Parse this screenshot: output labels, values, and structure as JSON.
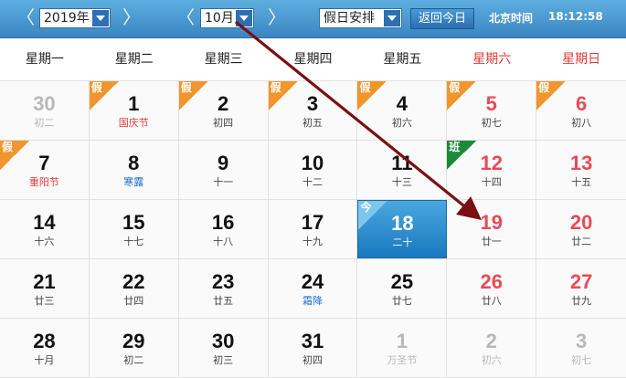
{
  "toolbar": {
    "prev_year": "〈",
    "year": "2019年",
    "next_year": "〉",
    "prev_month": "〈",
    "month": "10月",
    "next_month": "〉",
    "holiday_select": "假日安排",
    "today_button": "返回今日",
    "time_label": "北京时间",
    "time_value": "18:12:58"
  },
  "weekdays": [
    "星期一",
    "星期二",
    "星期三",
    "星期四",
    "星期五",
    "星期六",
    "星期日"
  ],
  "weeks": [
    [
      {
        "day": "30",
        "sub": "初二",
        "faded": true
      },
      {
        "day": "1",
        "sub": "国庆节",
        "subType": "fest",
        "badge": "假"
      },
      {
        "day": "2",
        "sub": "初四",
        "badge": "假"
      },
      {
        "day": "3",
        "sub": "初五",
        "badge": "假"
      },
      {
        "day": "4",
        "sub": "初六",
        "badge": "假"
      },
      {
        "day": "5",
        "sub": "初七",
        "badge": "假",
        "weekend": true
      },
      {
        "day": "6",
        "sub": "初八",
        "badge": "假",
        "weekend": true
      }
    ],
    [
      {
        "day": "7",
        "sub": "重阳节",
        "subType": "fest",
        "badge": "假"
      },
      {
        "day": "8",
        "sub": "寒露",
        "subType": "term"
      },
      {
        "day": "9",
        "sub": "十一"
      },
      {
        "day": "10",
        "sub": "十二"
      },
      {
        "day": "11",
        "sub": "十三"
      },
      {
        "day": "12",
        "sub": "十四",
        "badge": "班",
        "weekend": true
      },
      {
        "day": "13",
        "sub": "十五",
        "weekend": true
      }
    ],
    [
      {
        "day": "14",
        "sub": "十六"
      },
      {
        "day": "15",
        "sub": "十七"
      },
      {
        "day": "16",
        "sub": "十八"
      },
      {
        "day": "17",
        "sub": "十九"
      },
      {
        "day": "18",
        "sub": "二十",
        "badge": "今",
        "today": true
      },
      {
        "day": "19",
        "sub": "廿一",
        "weekend": true
      },
      {
        "day": "20",
        "sub": "廿二",
        "weekend": true
      }
    ],
    [
      {
        "day": "21",
        "sub": "廿三"
      },
      {
        "day": "22",
        "sub": "廿四"
      },
      {
        "day": "23",
        "sub": "廿五"
      },
      {
        "day": "24",
        "sub": "霜降",
        "subType": "term"
      },
      {
        "day": "25",
        "sub": "廿七"
      },
      {
        "day": "26",
        "sub": "廿八",
        "weekend": true
      },
      {
        "day": "27",
        "sub": "廿九",
        "weekend": true
      }
    ],
    [
      {
        "day": "28",
        "sub": "十月"
      },
      {
        "day": "29",
        "sub": "初二"
      },
      {
        "day": "30",
        "sub": "初三"
      },
      {
        "day": "31",
        "sub": "初四"
      },
      {
        "day": "1",
        "sub": "万圣节",
        "faded": true
      },
      {
        "day": "2",
        "sub": "初六",
        "faded": true
      },
      {
        "day": "3",
        "sub": "初七",
        "faded": true
      }
    ]
  ],
  "colors": {
    "toolbar": "#3a86c2",
    "weekend": "#e84a55",
    "holiday_badge": "#f1962c",
    "work_badge": "#1d8a3a",
    "today": "#1a78bf",
    "arrow": "#7a1010"
  }
}
